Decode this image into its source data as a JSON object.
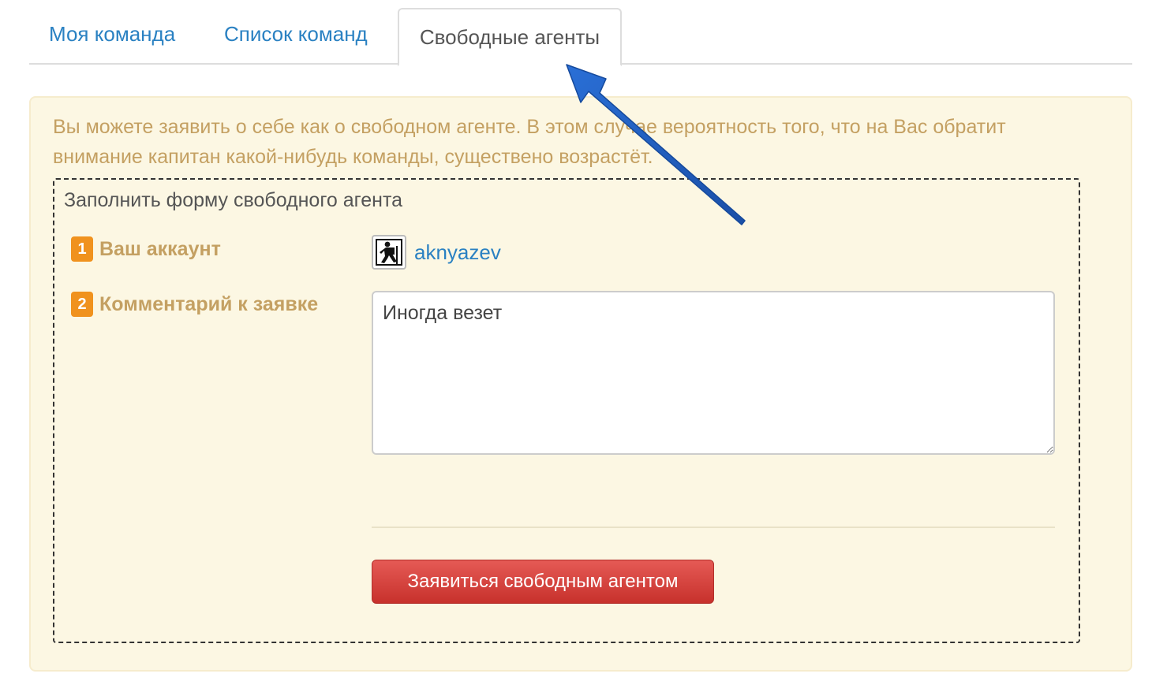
{
  "tabs": [
    {
      "label": "Моя команда"
    },
    {
      "label": "Список команд"
    },
    {
      "label": "Свободные агенты"
    }
  ],
  "active_tab": "Свободные агенты",
  "notice": {
    "text": "Вы можете заявить о себе как о свободном агенте. В этом случае вероятность того, что на Вас обратит внимание капитан какой-нибудь команды, существено возрастёт."
  },
  "form": {
    "legend": "Заполнить форму свободного агента",
    "account": {
      "step": "1",
      "label": "Ваш аккаунт",
      "username": "aknyazev"
    },
    "comment": {
      "step": "2",
      "label": "Комментарий к заявке",
      "value": "Иногда везет"
    },
    "submit_label": "Заявиться свободным агентом"
  },
  "colors": {
    "link": "#2a81c2",
    "panel_bg": "#fcf7e3",
    "panel_text": "#c4a062",
    "badge": "#f0921e",
    "button": "#d9403a",
    "annotation_arrow": "#1f5fc4"
  },
  "icons": {
    "avatar": "hiker-icon",
    "annotation": "arrow-annotation-icon"
  }
}
